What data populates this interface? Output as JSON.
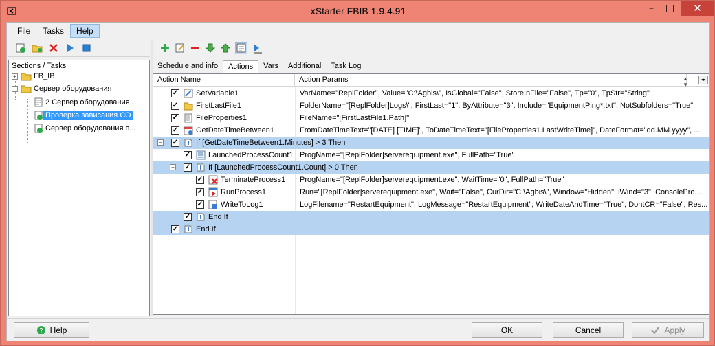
{
  "window": {
    "title": "xStarter FBIB 1.9.4.91"
  },
  "menu": [
    "File",
    "Tasks",
    "Help"
  ],
  "tree": {
    "header": "Sections / Tasks",
    "items": [
      {
        "label": "FB_IB",
        "type": "folder"
      },
      {
        "label": "Сервер оборудования",
        "type": "folder"
      },
      {
        "label": "2 Сервер оборудования ...",
        "type": "task"
      },
      {
        "label": "Проверка зависания СО",
        "type": "task-check",
        "selected": true
      },
      {
        "label": "Сервер оборудования п...",
        "type": "task-check"
      }
    ]
  },
  "tabs": [
    "Schedule and info",
    "Actions",
    "Vars",
    "Additional",
    "Task Log"
  ],
  "grid": {
    "columns": [
      "Action Name",
      "Action Params"
    ],
    "rows": [
      {
        "name": "SetVariable1",
        "params_pre": "VarName=\"ReplFolder\", Value=",
        "params_hl": "\"C:\\Agbis\\\"",
        "params_post": ", IsGlobal=\"False\", StoreInFile=\"False\", Tp=\"0\", TpStr=\"String\""
      },
      {
        "name": "FirstLastFile1",
        "params": "FolderName=\"[ReplFolder]Logs\\\", FirstLast=\"1\", ByAttribute=\"3\", Include=\"EquipmentPing*.txt\", NotSubfolders=\"True\""
      },
      {
        "name": "FileProperties1",
        "params": "FileName=\"[FirstLastFile1.Path]\""
      },
      {
        "name": "GetDateTimeBetween1",
        "params": "FromDateTimeText=\"[DATE] [TIME]\", ToDateTimeText=\"[FileProperties1.LastWriteTime]\", DateFormat=\"dd.MM.yyyy\", ..."
      },
      {
        "name": "If [GetDateTimeBetween1.Minutes] > 3 Then",
        "params": ""
      },
      {
        "name": "LaunchedProcessCount1",
        "params": "ProgName=\"[ReplFolder]serverequipment.exe\", FullPath=\"True\""
      },
      {
        "name": "If [LaunchedProcessCount1.Count] > 0 Then",
        "params": ""
      },
      {
        "name": "TerminateProcess1",
        "params": "ProgName=\"[ReplFolder]serverequipment.exe\", WaitTime=\"0\", FullPath=\"True\""
      },
      {
        "name": "RunProcess1",
        "params_pre": "Run=\"[ReplFolder]serverequipment.exe\", Wait=\"False\", CurDir=",
        "params_hl": "\"C:\\Agbis\\\"",
        "params_post": ", Window=\"Hidden\", iWind=\"3\", ConsolePro..."
      },
      {
        "name": "WriteToLog1",
        "params": "LogFilename=\"RestartEquipment\", LogMessage=\"RestartEquipment\", WriteDateAndTime=\"True\", DontCR=\"False\", Res..."
      },
      {
        "name": "End If",
        "params": ""
      },
      {
        "name": "End If",
        "params": ""
      }
    ]
  },
  "buttons": {
    "help": "Help",
    "ok": "OK",
    "cancel": "Cancel",
    "apply": "Apply"
  },
  "colors": {
    "frame": "#f08474",
    "selection": "#3399ff",
    "highlight_row": "#b6d3f2",
    "underline": "#e02020"
  }
}
